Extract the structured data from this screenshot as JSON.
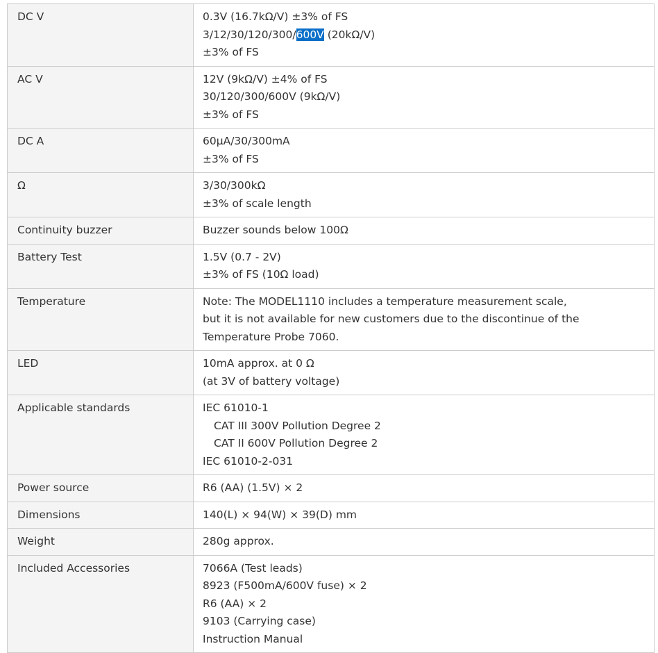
{
  "spec_table": {
    "rows": [
      {
        "label": "DC V",
        "lines": [
          {
            "text": "0.3V (16.7kΩ/V) ±3% of FS"
          },
          {
            "pre": "3/12/30/120/300/",
            "selected": "600V",
            "post": " (20kΩ/V)"
          },
          {
            "text": "±3% of FS"
          }
        ]
      },
      {
        "label": "AC V",
        "lines": [
          {
            "text": "12V (9kΩ/V) ±4% of FS"
          },
          {
            "text": "30/120/300/600V (9kΩ/V)"
          },
          {
            "text": "±3% of FS"
          }
        ]
      },
      {
        "label": "DC A",
        "lines": [
          {
            "text": "60μA/30/300mA"
          },
          {
            "text": "±3% of FS"
          }
        ]
      },
      {
        "label": "Ω",
        "lines": [
          {
            "text": "3/30/300kΩ"
          },
          {
            "text": "±3% of scale length"
          }
        ]
      },
      {
        "label": "Continuity buzzer",
        "lines": [
          {
            "text": "Buzzer sounds below 100Ω"
          }
        ]
      },
      {
        "label": "Battery Test",
        "lines": [
          {
            "text": "1.5V (0.7 - 2V)"
          },
          {
            "text": "±3% of FS (10Ω load)"
          }
        ]
      },
      {
        "label": "Temperature",
        "lines": [
          {
            "text": "Note: The MODEL1110 includes a temperature measurement scale,"
          },
          {
            "text": "but it is not available for new customers due to the discontinue of the"
          },
          {
            "text": "Temperature Probe 7060."
          }
        ]
      },
      {
        "label": "LED",
        "lines": [
          {
            "text": "10mA approx. at 0 Ω"
          },
          {
            "text": "(at 3V of battery voltage)"
          }
        ]
      },
      {
        "label": "Applicable standards",
        "lines": [
          {
            "text": "IEC 61010-1"
          },
          {
            "text": "CAT III 300V Pollution Degree 2",
            "indent": true
          },
          {
            "text": "CAT II 600V Pollution Degree 2",
            "indent": true
          },
          {
            "text": "IEC 61010-2-031"
          }
        ]
      },
      {
        "label": "Power source",
        "lines": [
          {
            "text": "R6 (AA) (1.5V) × 2"
          }
        ]
      },
      {
        "label": "Dimensions",
        "lines": [
          {
            "text": "140(L) × 94(W) × 39(D) mm"
          }
        ]
      },
      {
        "label": "Weight",
        "lines": [
          {
            "text": "280g approx."
          }
        ]
      },
      {
        "label": "Included Accessories",
        "lines": [
          {
            "text": "7066A (Test leads)"
          },
          {
            "text": "8923 (F500mA/600V fuse) × 2"
          },
          {
            "text": "R6 (AA) × 2"
          },
          {
            "text": "9103 (Carrying case)"
          },
          {
            "text": "Instruction Manual"
          }
        ]
      }
    ]
  },
  "colors": {
    "label_cell_bg": "#f4f4f4",
    "value_cell_bg": "#ffffff",
    "border": "#cccccc",
    "text": "#333333",
    "selection_bg": "#0a6fc8",
    "selection_text": "#ffffff"
  }
}
